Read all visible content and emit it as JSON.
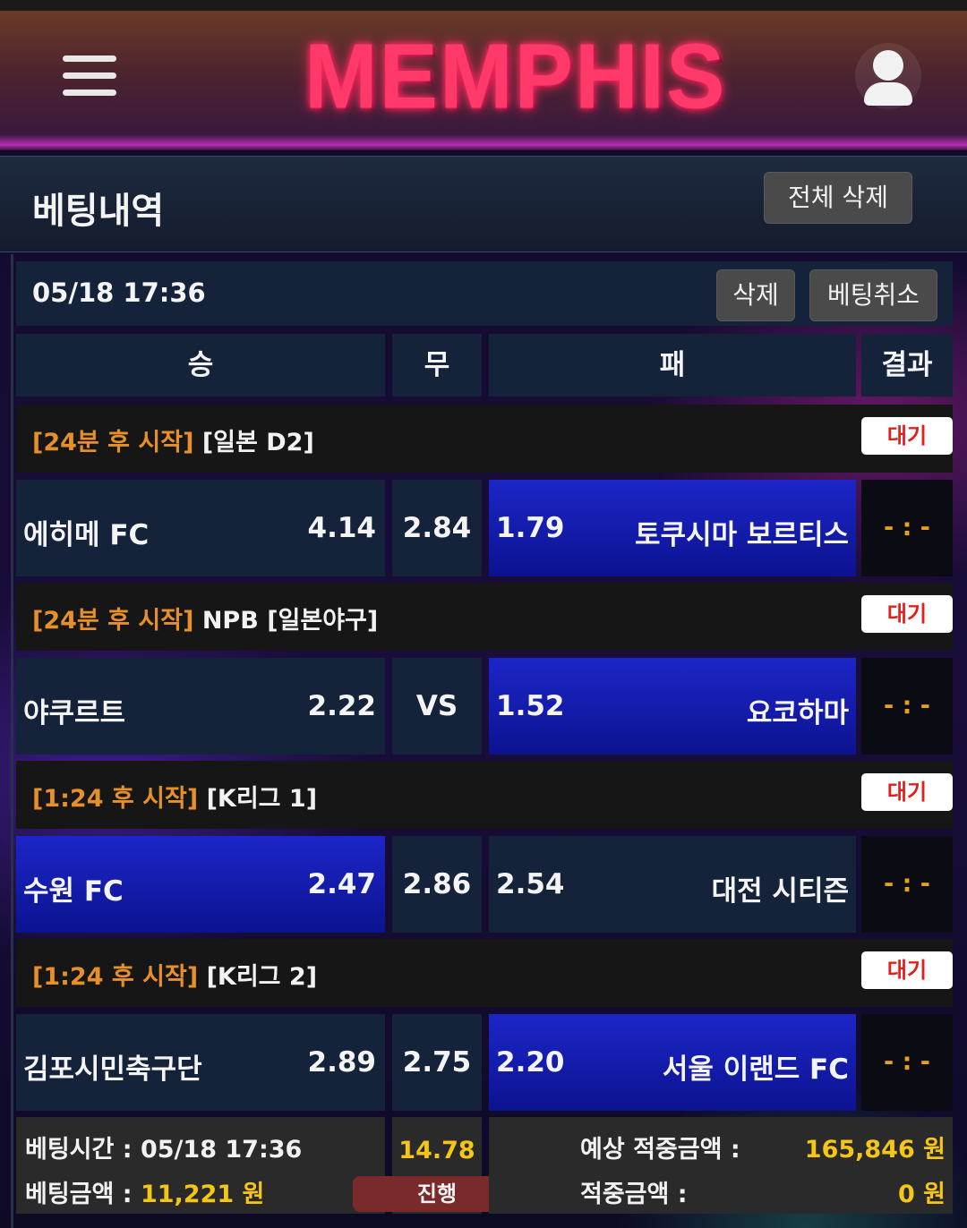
{
  "header": {
    "logo_text": "MEMPHIS"
  },
  "page": {
    "title": "베팅내역",
    "delete_all_label": "전체 삭제"
  },
  "bet": {
    "datetime": "05/18 17:36",
    "delete_label": "삭제",
    "cancel_label": "베팅취소",
    "columns": {
      "win": "승",
      "draw": "무",
      "lose": "패",
      "result": "결과"
    },
    "games": [
      {
        "start_info": "[24분 후 시작]",
        "league": "[일본 D2]",
        "status": "대기",
        "home_team": "에히메 FC",
        "home_odds": "4.14",
        "draw": "2.84",
        "away_odds": "1.79",
        "away_team": "토쿠시마 보르티스",
        "selected": "away",
        "result": "- : -"
      },
      {
        "start_info": "[24분 후 시작]",
        "league": "NPB [일본야구]",
        "status": "대기",
        "home_team": "야쿠르트",
        "home_odds": "2.22",
        "draw": "VS",
        "away_odds": "1.52",
        "away_team": "요코하마",
        "selected": "away",
        "result": "- : -"
      },
      {
        "start_info": "[1:24 후 시작]",
        "league": "[K리그 1]",
        "status": "대기",
        "home_team": "수원 FC",
        "home_odds": "2.47",
        "draw": "2.86",
        "away_odds": "2.54",
        "away_team": "대전 시티즌",
        "selected": "home",
        "result": "- : -"
      },
      {
        "start_info": "[1:24 후 시작]",
        "league": "[K리그 2]",
        "status": "대기",
        "home_team": "김포시민축구단",
        "home_odds": "2.89",
        "draw": "2.75",
        "away_odds": "2.20",
        "away_team": "서울 이랜드 FC",
        "selected": "away",
        "result": "- : -"
      }
    ],
    "summary": {
      "bet_time_label": "베팅시간 :",
      "bet_time_value": "05/18 17:36",
      "bet_amount_label": "베팅금액 :",
      "bet_amount_value": "11,221 원",
      "total_odds": "14.78",
      "progress_label": "진행",
      "expected_label": "예상 적중금액 :",
      "expected_value": "165,846 원",
      "win_label": "적중금액 :",
      "win_value": "0 원"
    }
  },
  "colors": {
    "selected_cell": "#1c26c8",
    "cell": "#15233a",
    "start_info": "#e7902a",
    "status_text": "#e01f1f",
    "highlight_amount": "#f5c518"
  }
}
